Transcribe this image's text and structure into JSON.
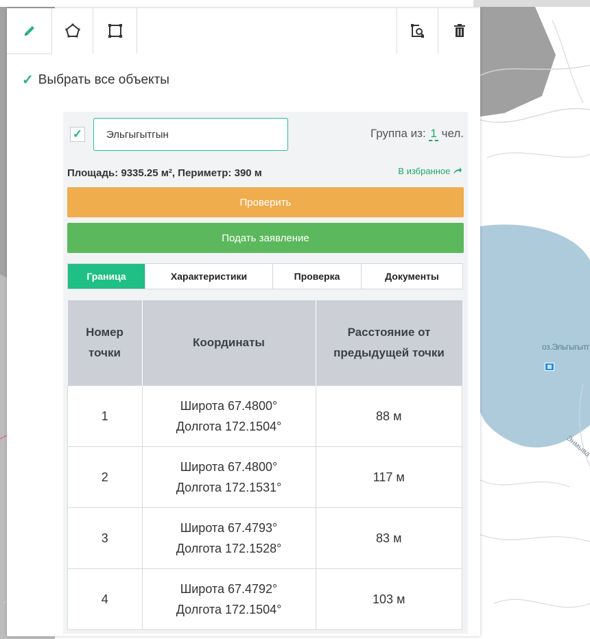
{
  "toolbar": {
    "tools": [
      "pencil-icon",
      "polygon-icon",
      "rectangle-icon",
      "zoom-to-icon",
      "trash-icon"
    ]
  },
  "select_all": {
    "label": "Выбрать все объекты",
    "checked": true
  },
  "object": {
    "checked": true,
    "name": "Эльгыгытгын",
    "group_label": "Группа из:",
    "group_count": "1",
    "group_unit": "чел.",
    "measurements": "Площадь: 9335.25 м², Периметр: 390 м",
    "favorite_label": "В избранное"
  },
  "buttons": {
    "check": "Проверить",
    "submit": "Подать заявление"
  },
  "tabs": [
    {
      "label": "Граница",
      "active": true
    },
    {
      "label": "Характеристики",
      "active": false
    },
    {
      "label": "Проверка",
      "active": false
    },
    {
      "label": "Документы",
      "active": false
    }
  ],
  "table": {
    "headers": [
      "Номер точки",
      "Координаты",
      "Расстояние от предыдущей точки"
    ],
    "rows": [
      {
        "n": "1",
        "lat": "Широта 67.4800°",
        "lon": "Долгота 172.1504°",
        "dist": "88 м"
      },
      {
        "n": "2",
        "lat": "Широта 67.4800°",
        "lon": "Долгота 172.1531°",
        "dist": "117 м"
      },
      {
        "n": "3",
        "lat": "Широта 67.4793°",
        "lon": "Долгота 172.1528°",
        "dist": "83 м"
      },
      {
        "n": "4",
        "lat": "Широта 67.4792°",
        "lon": "Долгота 172.1504°",
        "dist": "103 м"
      }
    ]
  },
  "map": {
    "lake_label": "оз.Эльгыгытгын",
    "river_label": "Энмыва"
  },
  "colors": {
    "accent": "#1fbf85",
    "check_btn": "#f0ad4e",
    "submit_btn": "#5cb85c",
    "lake": "#aecbdc",
    "terrain_dark": "#9f9f9f"
  }
}
